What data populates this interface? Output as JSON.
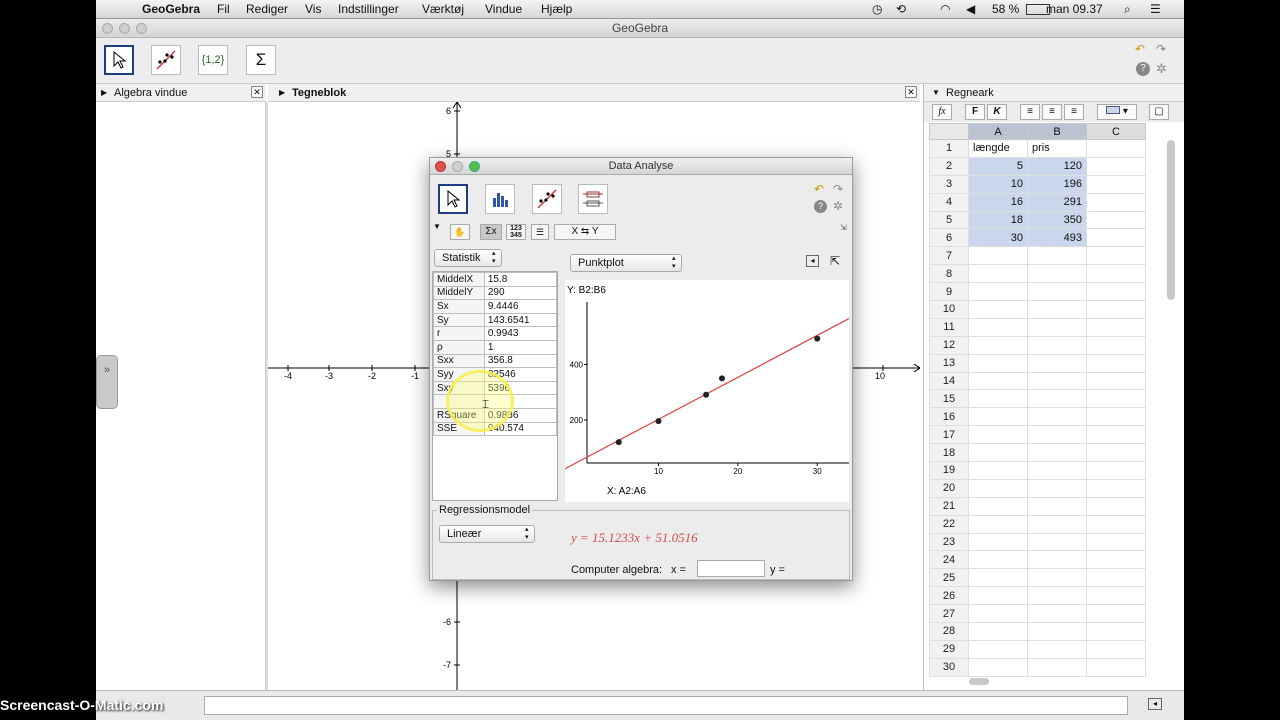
{
  "menubar": {
    "app": "GeoGebra",
    "items": [
      "Fil",
      "Rediger",
      "Vis",
      "Indstillinger",
      "Værktøj",
      "Vindue",
      "Hjælp"
    ],
    "battery": "58 %",
    "clock": "man 09.37"
  },
  "window": {
    "title": "GeoGebra"
  },
  "toolbar": {
    "tools": [
      "move-tool",
      "line-fit-tool",
      "{1,2}",
      "Σ"
    ]
  },
  "panels": {
    "algebra": "Algebra vindue",
    "graphics": "Tegneblok",
    "spreadsheet": "Regneark"
  },
  "graphics": {
    "xticks": [
      "-4",
      "-3",
      "-2",
      "-1",
      "10"
    ],
    "yticks": [
      "6",
      "5",
      "-6",
      "-7"
    ]
  },
  "sheet": {
    "toolbar": [
      "fx",
      "F",
      "K"
    ],
    "columns": [
      "A",
      "B",
      "C"
    ],
    "rows": [
      [
        "1",
        "længde",
        "pris"
      ],
      [
        "2",
        "5",
        "120"
      ],
      [
        "3",
        "10",
        "196"
      ],
      [
        "4",
        "16",
        "291"
      ],
      [
        "5",
        "18",
        "350"
      ],
      [
        "6",
        "30",
        "493"
      ],
      [
        "7",
        "",
        ""
      ],
      [
        "8",
        "",
        ""
      ],
      [
        "9",
        "",
        ""
      ],
      [
        "10",
        "",
        ""
      ],
      [
        "11",
        "",
        ""
      ],
      [
        "12",
        "",
        ""
      ],
      [
        "13",
        "",
        ""
      ],
      [
        "14",
        "",
        ""
      ],
      [
        "15",
        "",
        ""
      ],
      [
        "16",
        "",
        ""
      ],
      [
        "17",
        "",
        ""
      ],
      [
        "18",
        "",
        ""
      ],
      [
        "19",
        "",
        ""
      ],
      [
        "20",
        "",
        ""
      ],
      [
        "21",
        "",
        ""
      ],
      [
        "22",
        "",
        ""
      ],
      [
        "23",
        "",
        ""
      ],
      [
        "24",
        "",
        ""
      ],
      [
        "25",
        "",
        ""
      ],
      [
        "26",
        "",
        ""
      ],
      [
        "27",
        "",
        ""
      ],
      [
        "28",
        "",
        ""
      ],
      [
        "29",
        "",
        ""
      ],
      [
        "30",
        "",
        ""
      ]
    ]
  },
  "dialog": {
    "title": "Data Analyse",
    "modes": [
      "Σx",
      "123\n345",
      "",
      "X ⇆ Y"
    ],
    "stats_dropdown": "Statistik",
    "plot_dropdown": "Punktplot",
    "stats": [
      [
        "MiddelX",
        "15.8"
      ],
      [
        "MiddelY",
        "290"
      ],
      [
        "Sx",
        "9.4446"
      ],
      [
        "Sy",
        "143.6541"
      ],
      [
        "r",
        "0.9943"
      ],
      [
        "ρ",
        "1"
      ],
      [
        "Sxx",
        "356.8"
      ],
      [
        "Syy",
        "82546"
      ],
      [
        "Sxy",
        "5396"
      ],
      [
        "",
        ""
      ],
      [
        "RSquare",
        "0.9886"
      ],
      [
        "SSE",
        "940.574"
      ]
    ],
    "plot_ylabel": "Y:  B2:B6",
    "plot_xlabel": "X:   A2:A6",
    "regression_legend": "Regressionsmodel",
    "regression_model": "Lineær",
    "formula": "y = 15.1233x + 51.0516",
    "cas_label": "Computer algebra:",
    "cas_x": "x =",
    "cas_x_value": "",
    "cas_y": "y ="
  },
  "chart_data": {
    "type": "scatter",
    "title": "",
    "xlabel": "X:   A2:A6",
    "ylabel": "Y:  B2:B6",
    "x": [
      5,
      10,
      16,
      18,
      30
    ],
    "y": [
      120,
      196,
      291,
      350,
      493
    ],
    "xticks": [
      10,
      20,
      30
    ],
    "yticks": [
      200,
      400
    ],
    "xlim": [
      1,
      34
    ],
    "ylim": [
      45,
      625
    ],
    "regression": {
      "slope": 15.1233,
      "intercept": 51.0516,
      "color": "#e03c3c"
    },
    "point_color": "#222222"
  },
  "watermark": "Screencast-O-Matic.com"
}
